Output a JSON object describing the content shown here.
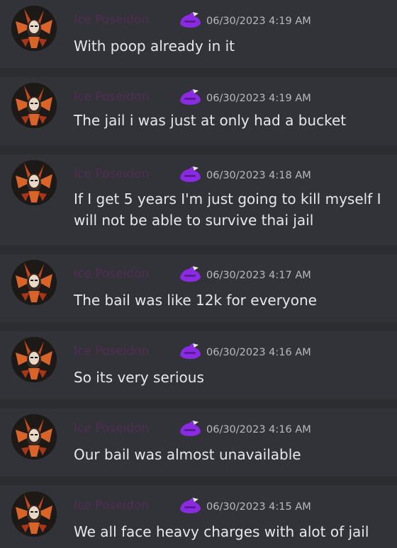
{
  "messages": [
    {
      "username": "Ice Poseidon",
      "timestamp": "06/30/2023 4:19 AM",
      "text": "With poop already in it"
    },
    {
      "username": "Ice Poseidon",
      "timestamp": "06/30/2023 4:19 AM",
      "text": "The jail i was just at only had a bucket"
    },
    {
      "username": "Ice Poseidon",
      "timestamp": "06/30/2023 4:18 AM",
      "text": "If I get 5 years I'm just going to kill myself I will not be able to survive thai jail"
    },
    {
      "username": "Ice Poseidon",
      "timestamp": "06/30/2023 4:17 AM",
      "text": "The bail was like 12k for everyone"
    },
    {
      "username": "Ice Poseidon",
      "timestamp": "06/30/2023 4:16 AM",
      "text": "So its very serious"
    },
    {
      "username": "Ice Poseidon",
      "timestamp": "06/30/2023 4:16 AM",
      "text": "Our bail was almost unavailable"
    },
    {
      "username": "Ice Poseidon",
      "timestamp": "06/30/2023 4:15 AM",
      "text": "We all face heavy charges with alot of jail"
    }
  ],
  "colors": {
    "background": "#313338",
    "separator": "#2b2d31",
    "username": "#5d2a5e",
    "timestamp": "#b5bac1",
    "text": "#e6e7ea",
    "role_icon": "#8a2be2"
  },
  "icons": {
    "avatar": "avatar-image",
    "role": "role-icon"
  }
}
